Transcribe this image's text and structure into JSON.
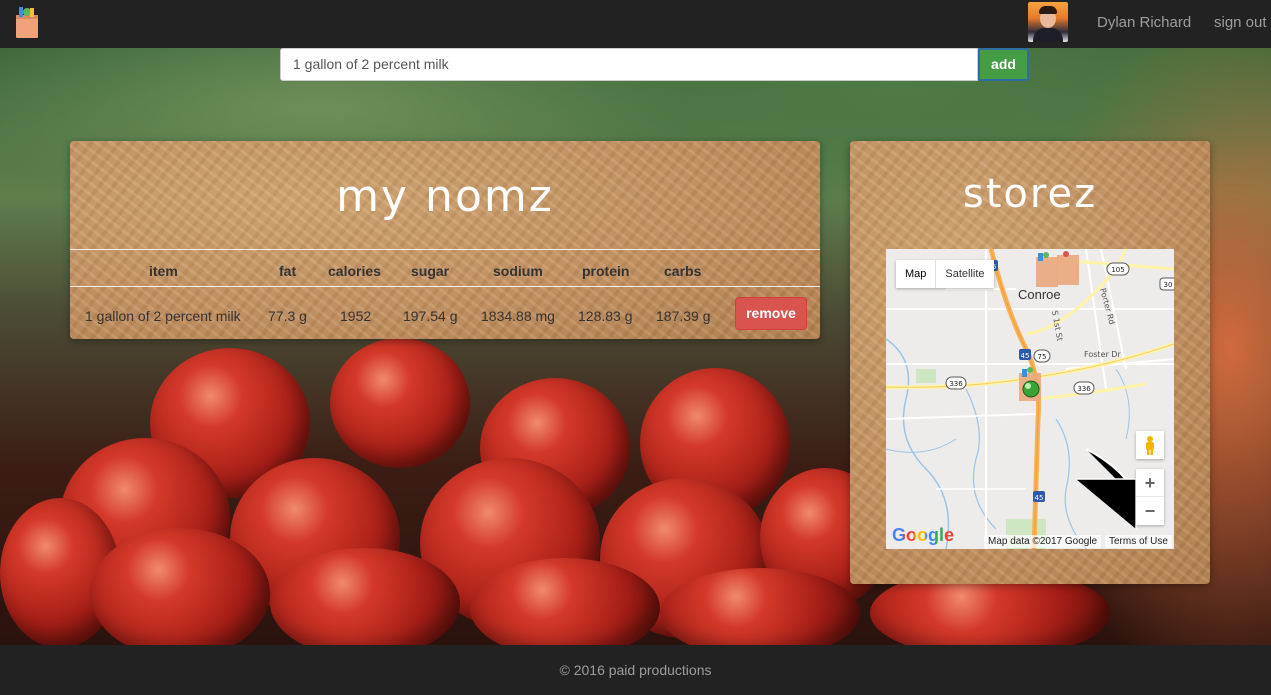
{
  "nav": {
    "user_name": "Dylan Richard",
    "signout_label": "sign out"
  },
  "add_bar": {
    "input_value": "1 gallon of 2 percent milk",
    "add_label": "add"
  },
  "nomz": {
    "title": "my nomz",
    "columns": [
      "item",
      "fat",
      "calories",
      "sugar",
      "sodium",
      "protein",
      "carbs"
    ],
    "rows": [
      {
        "item": "1 gallon of 2 percent milk",
        "fat": "77.3 g",
        "calories": "1952",
        "sugar": "197.54 g",
        "sodium": "1834.88 mg",
        "protein": "128.83 g",
        "carbs": "187.39 g",
        "remove_label": "remove"
      }
    ]
  },
  "storez": {
    "title": "storez",
    "map": {
      "type_map": "Map",
      "type_satellite": "Satellite",
      "town": "Conroe",
      "zoom_in": "+",
      "zoom_out": "−",
      "brand": "Google",
      "attribution": "Map data ©2017 Google",
      "terms": "Terms of Use",
      "shields": [
        "45",
        "105",
        "75",
        "336",
        "336",
        "45",
        "30"
      ],
      "road_labels": [
        "Foster Dr",
        "Porter Rd",
        "S 1st St"
      ]
    }
  },
  "footer": {
    "text": "© 2016 paid productions"
  },
  "colors": {
    "nav_bg": "#222222",
    "add_button": "#449d44",
    "remove_button": "#d9534f",
    "title_text": "#ffffff"
  }
}
